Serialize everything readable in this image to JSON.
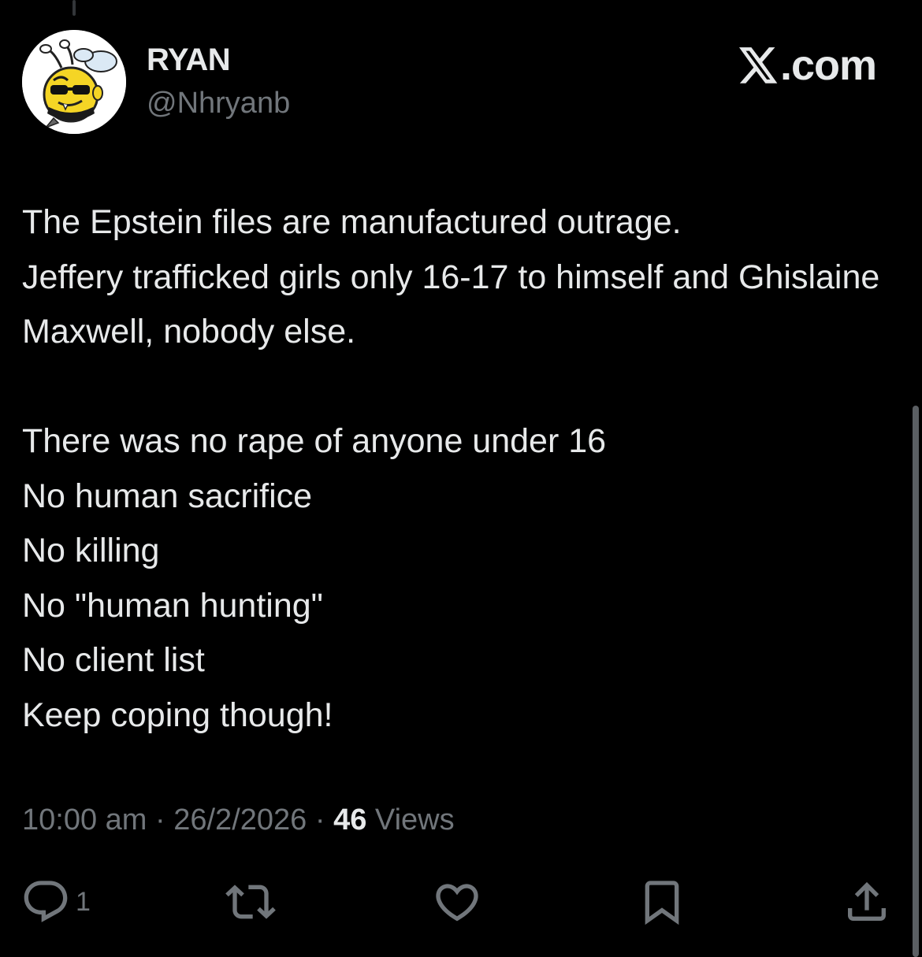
{
  "author": {
    "display_name": "RYAN",
    "handle": "@Nhryanb"
  },
  "brand": {
    "label": ".com",
    "logo_icon": "x-logo-icon"
  },
  "tweet": {
    "text": "The Epstein files are manufactured outrage.\nJeffery trafficked girls only 16-17 to himself and Ghislaine Maxwell, nobody else.\n\nThere was no rape of anyone under 16\nNo human sacrifice\nNo killing\nNo \"human hunting\"\nNo client list\nKeep coping though!",
    "time": "10:00 am",
    "separator": " · ",
    "date": "26/2/2026",
    "views_count": "46",
    "views_label": " Views"
  },
  "actions": {
    "reply": {
      "icon": "reply-icon",
      "count": "1"
    },
    "repost": {
      "icon": "repost-icon"
    },
    "like": {
      "icon": "heart-icon"
    },
    "bookmark": {
      "icon": "bookmark-icon"
    },
    "share": {
      "icon": "share-icon"
    }
  },
  "colors": {
    "background": "#000000",
    "primary_text": "#e7e9ea",
    "secondary_text": "#71767b"
  }
}
